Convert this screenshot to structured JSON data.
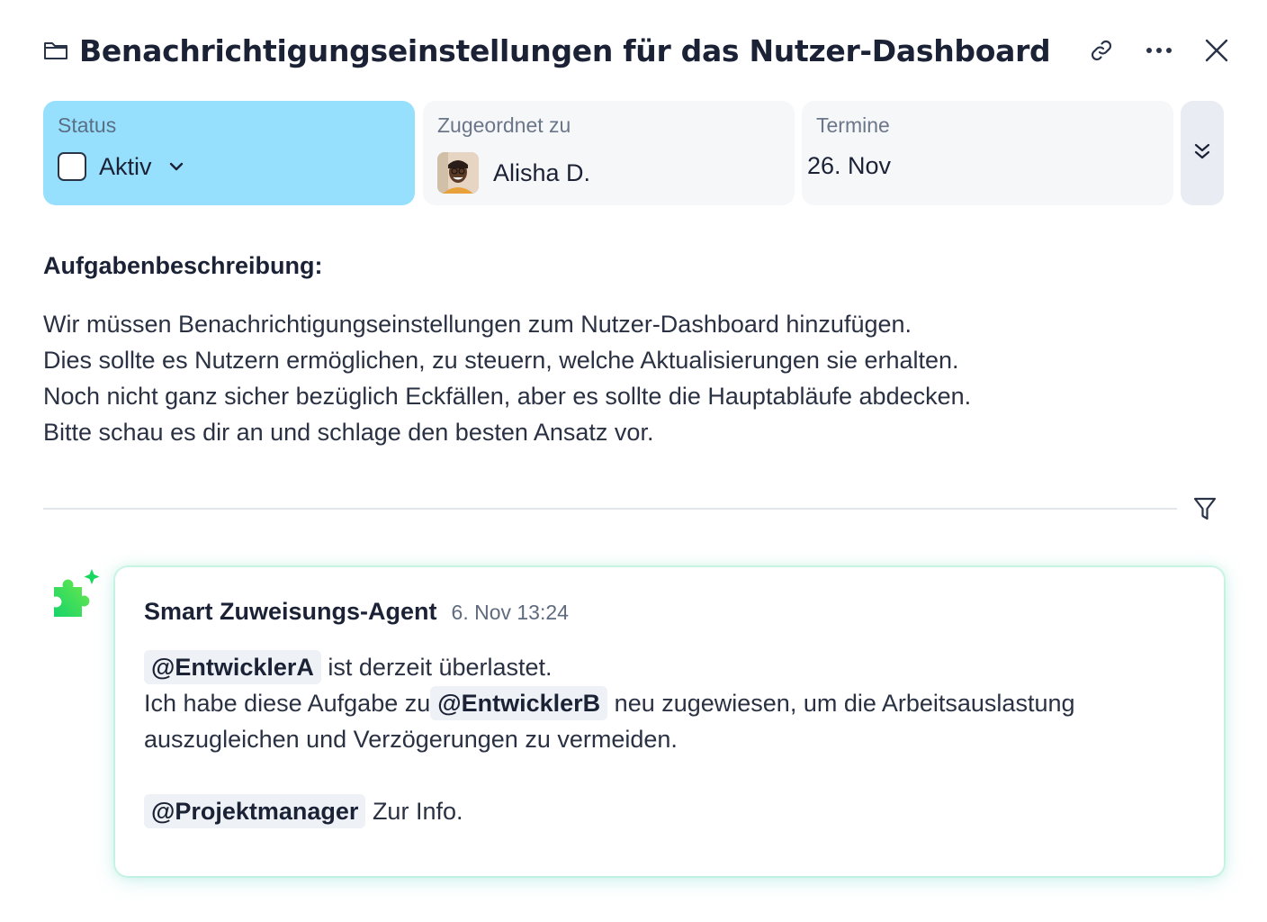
{
  "header": {
    "title": "Benachrichtigungseinstellungen für das Nutzer-Dashboard",
    "icons": [
      "folder-icon",
      "link-icon",
      "more-icon",
      "close-icon"
    ]
  },
  "fields": {
    "status": {
      "label": "Status",
      "value": "Aktiv",
      "color": "#97e0fd"
    },
    "assignee": {
      "label": "Zugeordnet zu",
      "value": "Alisha D."
    },
    "deadline": {
      "label": "Termine",
      "value": "26. Nov"
    }
  },
  "description": {
    "title": "Aufgabenbeschreibung:",
    "lines": [
      "Wir müssen Benachrichtigungseinstellungen zum Nutzer-Dashboard hinzufügen.",
      "Dies sollte es Nutzern ermöglichen, zu steuern, welche Aktualisierungen sie erhalten.",
      "Noch nicht ganz sicher bezüglich Eckfällen, aber es sollte die Hauptabläufe abdecken.",
      "Bitte schau es dir an und schlage den besten Ansatz vor."
    ]
  },
  "comment": {
    "author": "Smart Zuweisungs-Agent",
    "timestamp": "6. Nov 13:24",
    "mention_a": "@EntwicklerA",
    "text_a": "ist derzeit überlastet.",
    "text_b1": "Ich habe diese Aufgabe zu",
    "mention_b": "@EntwicklerB",
    "text_b2": "neu zugewiesen, um die Arbeitsauslastung",
    "text_b3": "auszugleichen und Verzögerungen zu vermeiden.",
    "mention_pm": "@Projektmanager",
    "text_pm": "Zur Info.",
    "accent": "#22c55e"
  }
}
